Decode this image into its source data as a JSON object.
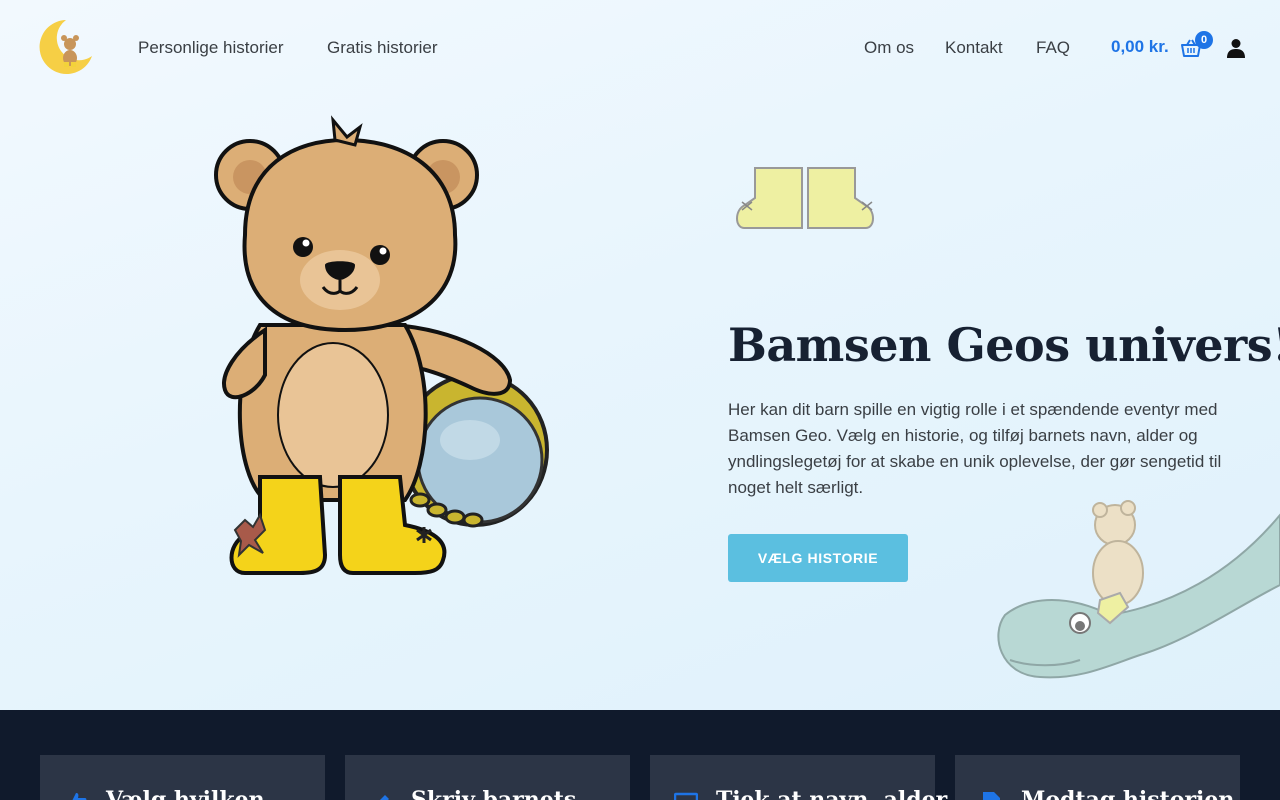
{
  "brand": {
    "logo_icon": "moon-bear-logo-icon"
  },
  "nav": {
    "left": [
      {
        "label": "Personlige historier"
      },
      {
        "label": "Gratis historier"
      }
    ],
    "right": [
      {
        "label": "Om os"
      },
      {
        "label": "Kontakt"
      },
      {
        "label": "FAQ"
      }
    ],
    "cart_total": "0,00 kr.",
    "cart_count": "0",
    "cart_icon": "basket-icon",
    "user_icon": "user-icon",
    "accent_color": "#1e74e6"
  },
  "hero": {
    "title": "Bamsen Geos univers!",
    "text": "Her kan dit barn spille en vigtig rolle i et spændende eventyr med Bamsen Geo. Vælg en historie, og tilføj barnets navn, alder og yndlingslegetøj for at skabe en unik oplevelse, der gør sengetid til noget helt særligt.",
    "cta_label": "VÆLG HISTORIE",
    "cta_color": "#5bbfe0"
  },
  "steps": [
    {
      "icon": "thumbs-up-icon",
      "title": "Vælg hvilken"
    },
    {
      "icon": "pencil-icon",
      "title": "Skriv barnets"
    },
    {
      "icon": "monitor-icon",
      "title": "Tjek at navn, alder"
    },
    {
      "icon": "document-icon",
      "title": "Modtag historien"
    }
  ],
  "section_bg": "#101a2c"
}
